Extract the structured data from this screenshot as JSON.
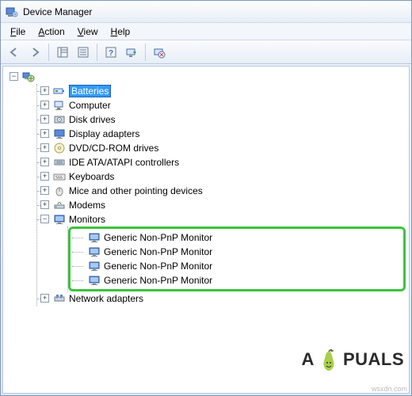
{
  "window": {
    "title": "Device Manager"
  },
  "menu": {
    "file": "File",
    "action": "Action",
    "view": "View",
    "help": "Help"
  },
  "expander": {
    "plus": "+",
    "minus": "−"
  },
  "tree": {
    "root_expanded": true,
    "items": [
      {
        "label": "Batteries",
        "selected": true,
        "icon": "battery"
      },
      {
        "label": "Computer",
        "icon": "computer"
      },
      {
        "label": "Disk drives",
        "icon": "disk"
      },
      {
        "label": "Display adapters",
        "icon": "display"
      },
      {
        "label": "DVD/CD-ROM drives",
        "icon": "cd"
      },
      {
        "label": "IDE ATA/ATAPI controllers",
        "icon": "ide"
      },
      {
        "label": "Keyboards",
        "icon": "keyboard"
      },
      {
        "label": "Mice and other pointing devices",
        "icon": "mouse"
      },
      {
        "label": "Modems",
        "icon": "modem"
      },
      {
        "label": "Monitors",
        "icon": "monitor",
        "expanded": true,
        "children": [
          {
            "label": "Generic Non-PnP Monitor",
            "icon": "monitor"
          },
          {
            "label": "Generic Non-PnP Monitor",
            "icon": "monitor"
          },
          {
            "label": "Generic Non-PnP Monitor",
            "icon": "monitor"
          },
          {
            "label": "Generic Non-PnP Monitor",
            "icon": "monitor"
          }
        ]
      },
      {
        "label": "Network adapters",
        "icon": "network"
      }
    ]
  },
  "brand": {
    "pre": "A",
    "post": "PUALS"
  },
  "watermark": "wsxdn.com"
}
